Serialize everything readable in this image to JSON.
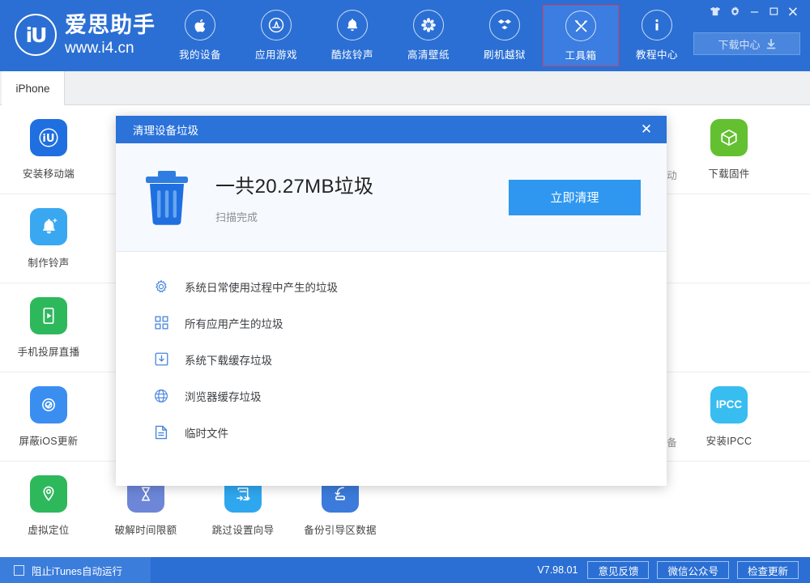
{
  "window": {
    "controls": [
      {
        "name": "skin-icon",
        "label": "皮肤"
      },
      {
        "name": "settings-icon",
        "label": "设置"
      },
      {
        "name": "minimize-icon",
        "label": "最小化"
      },
      {
        "name": "maximize-icon",
        "label": "最大化"
      },
      {
        "name": "close-icon",
        "label": "关闭"
      }
    ]
  },
  "brand": {
    "logo_text": "iU",
    "name": "爱思助手",
    "url": "www.i4.cn"
  },
  "nav": {
    "items": [
      {
        "label": "我的设备",
        "icon": "apple-icon",
        "active": false
      },
      {
        "label": "应用游戏",
        "icon": "appstore-icon",
        "active": false
      },
      {
        "label": "酷炫铃声",
        "icon": "bell-icon",
        "active": false
      },
      {
        "label": "高清壁纸",
        "icon": "flower-icon",
        "active": false
      },
      {
        "label": "刷机越狱",
        "icon": "dropbox-icon",
        "active": false
      },
      {
        "label": "工具箱",
        "icon": "tools-icon",
        "active": true
      },
      {
        "label": "教程中心",
        "icon": "info-icon",
        "active": false
      }
    ]
  },
  "download_center": {
    "label": "下载中心",
    "icon": "download-icon"
  },
  "tabs": [
    {
      "label": "iPhone",
      "active": true
    }
  ],
  "colors": {
    "brand_blue": "#2b6fd4",
    "dialog_blue": "#2b72d9",
    "cta_blue": "#2f97f0",
    "active_tab_border": "#cc4466"
  },
  "grid": {
    "rows": [
      [
        {
          "label": "安装移动端",
          "icon": "i4-app-icon",
          "color": "#1f6fe0"
        },
        {
          "label": "",
          "icon": "",
          "color": "",
          "hidden": true
        },
        {
          "label": "",
          "icon": "",
          "color": "",
          "hidden": true
        },
        {
          "label": "",
          "icon": "",
          "color": "",
          "hidden": true
        },
        {
          "label": "",
          "icon": "",
          "color": "",
          "hidden": true
        },
        {
          "label": "",
          "icon": "",
          "color": "",
          "hidden": true
        },
        {
          "label": "动",
          "icon": "",
          "color": "",
          "partial": true
        },
        {
          "label": "下载固件",
          "icon": "cube-icon",
          "color": "#63c030"
        }
      ],
      [
        {
          "label": "制作铃声",
          "icon": "bell-plus-icon",
          "color": "#39a8f0"
        },
        {
          "label": "",
          "icon": "",
          "color": "",
          "hidden": true
        },
        {
          "label": "",
          "icon": "",
          "color": "",
          "hidden": true
        },
        {
          "label": "",
          "icon": "",
          "color": "",
          "hidden": true
        },
        {
          "label": "",
          "icon": "",
          "color": "",
          "hidden": true
        },
        {
          "label": "",
          "icon": "",
          "color": "",
          "hidden": true
        },
        {
          "label": "",
          "icon": "",
          "color": "",
          "hidden": true
        },
        {
          "label": "",
          "icon": "",
          "color": "",
          "hidden": true
        }
      ],
      [
        {
          "label": "手机投屏直播",
          "icon": "screen-cast-icon",
          "color": "#2eb85c"
        },
        {
          "label": "",
          "icon": "",
          "color": "",
          "hidden": true
        },
        {
          "label": "",
          "icon": "",
          "color": "",
          "hidden": true
        },
        {
          "label": "",
          "icon": "",
          "color": "",
          "hidden": true
        },
        {
          "label": "",
          "icon": "",
          "color": "",
          "hidden": true
        },
        {
          "label": "",
          "icon": "",
          "color": "",
          "hidden": true
        },
        {
          "label": "",
          "icon": "",
          "color": "",
          "hidden": true
        },
        {
          "label": "",
          "icon": "",
          "color": "",
          "hidden": true
        }
      ],
      [
        {
          "label": "屏蔽iOS更新",
          "icon": "block-update-icon",
          "color": "#3a8ef0"
        },
        {
          "label": "",
          "icon": "",
          "color": "",
          "hidden": true
        },
        {
          "label": "",
          "icon": "",
          "color": "",
          "hidden": true
        },
        {
          "label": "",
          "icon": "",
          "color": "",
          "hidden": true
        },
        {
          "label": "",
          "icon": "",
          "color": "",
          "hidden": true
        },
        {
          "label": "",
          "icon": "",
          "color": "",
          "hidden": true
        },
        {
          "label": "备",
          "icon": "",
          "color": "",
          "partial": true
        },
        {
          "label": "安装IPCC",
          "icon": "ipcc-icon",
          "color": "#37bdf0"
        }
      ],
      [
        {
          "label": "虚拟定位",
          "icon": "location-icon",
          "color": "#2eb85c"
        },
        {
          "label": "破解时间限额",
          "icon": "hourglass-icon",
          "color": "#6d86d8"
        },
        {
          "label": "跳过设置向导",
          "icon": "skip-setup-icon",
          "color": "#2fa7ef"
        },
        {
          "label": "备份引导区数据",
          "icon": "backup-boot-icon",
          "color": "#3c7bdb"
        },
        {
          "label": "",
          "icon": "",
          "color": "",
          "hidden": true
        },
        {
          "label": "",
          "icon": "",
          "color": "",
          "hidden": true
        },
        {
          "label": "",
          "icon": "",
          "color": "",
          "hidden": true
        },
        {
          "label": "",
          "icon": "",
          "color": "",
          "hidden": true
        }
      ]
    ]
  },
  "dialog": {
    "title": "清理设备垃圾",
    "close_label": "✕",
    "headline": "一共20.27MB垃圾",
    "subtext": "扫描完成",
    "cta_label": "立即清理",
    "trash_icon": "trash-icon",
    "items": [
      {
        "label": "系统日常使用过程中产生的垃圾",
        "icon": "gear-icon"
      },
      {
        "label": "所有应用产生的垃圾",
        "icon": "grid-apps-icon"
      },
      {
        "label": "系统下载缓存垃圾",
        "icon": "download-box-icon"
      },
      {
        "label": "浏览器缓存垃圾",
        "icon": "globe-icon"
      },
      {
        "label": "临时文件",
        "icon": "document-icon"
      }
    ]
  },
  "statusbar": {
    "block_itunes_label": "阻止iTunes自动运行",
    "block_itunes_checked": false,
    "version": "V7.98.01",
    "buttons": [
      {
        "label": "意见反馈"
      },
      {
        "label": "微信公众号"
      },
      {
        "label": "检查更新"
      }
    ]
  }
}
